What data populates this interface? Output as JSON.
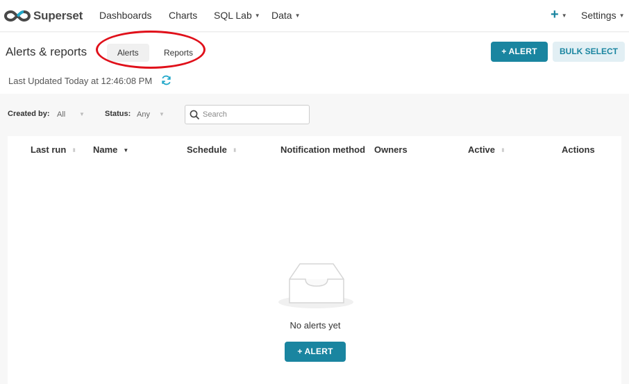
{
  "nav": {
    "brand": "Superset",
    "items": [
      {
        "label": "Dashboards"
      },
      {
        "label": "Charts"
      },
      {
        "label": "SQL Lab"
      },
      {
        "label": "Data"
      }
    ],
    "plus": "+",
    "settings": "Settings"
  },
  "header": {
    "title": "Alerts & reports",
    "tabs": [
      {
        "label": "Alerts",
        "active": true
      },
      {
        "label": "Reports",
        "active": false
      }
    ],
    "alert_button": "+ ALERT",
    "bulk_select_button": "BULK SELECT",
    "last_updated": "Last Updated Today at 12:46:08 PM"
  },
  "filters": {
    "created_by_label": "Created by:",
    "created_by_value": "All",
    "status_label": "Status:",
    "status_value": "Any",
    "search_placeholder": "Search"
  },
  "table": {
    "columns": [
      {
        "label": "Last run"
      },
      {
        "label": "Name"
      },
      {
        "label": "Schedule"
      },
      {
        "label": "Notification method"
      },
      {
        "label": "Owners"
      },
      {
        "label": "Active"
      },
      {
        "label": "Actions"
      }
    ],
    "empty_text": "No alerts yet",
    "empty_button": "+ ALERT"
  },
  "colors": {
    "primary": "#1a85a0",
    "annotation": "#e0101a"
  }
}
